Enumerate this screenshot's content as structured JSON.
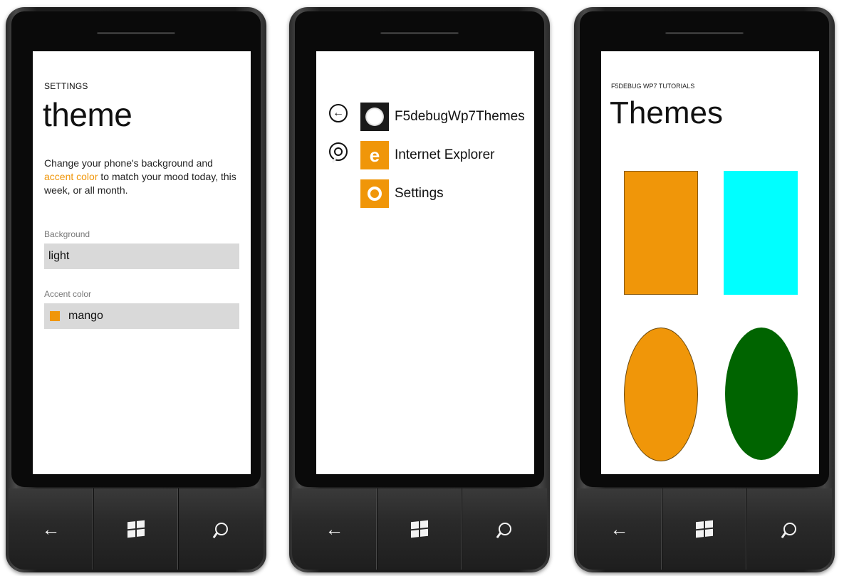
{
  "colors": {
    "accent": "#f09609",
    "cyan": "#00ffff",
    "green": "#006400"
  },
  "phone1": {
    "small_title": "SETTINGS",
    "title": "theme",
    "desc_before": "Change your phone's background and",
    "desc_accent": "accent color",
    "desc_after": "to match your mood today, this week, or all month.",
    "background_label": "Background",
    "background_value": "light",
    "accent_label": "Accent color",
    "accent_value": "mango"
  },
  "phone2": {
    "items": [
      {
        "label": "F5debugWp7Themes",
        "icon": "app-icon"
      },
      {
        "label": "Internet Explorer",
        "icon": "ie-icon"
      },
      {
        "label": "Settings",
        "icon": "settings-gear-icon"
      }
    ]
  },
  "phone3": {
    "small_title": "F5DEBUG WP7 TUTORIALS",
    "title": "Themes",
    "shapes": [
      {
        "kind": "rectangle",
        "color": "#f09609"
      },
      {
        "kind": "rectangle",
        "color": "#00ffff"
      },
      {
        "kind": "ellipse",
        "color": "#f09609"
      },
      {
        "kind": "ellipse",
        "color": "#006400"
      }
    ]
  }
}
